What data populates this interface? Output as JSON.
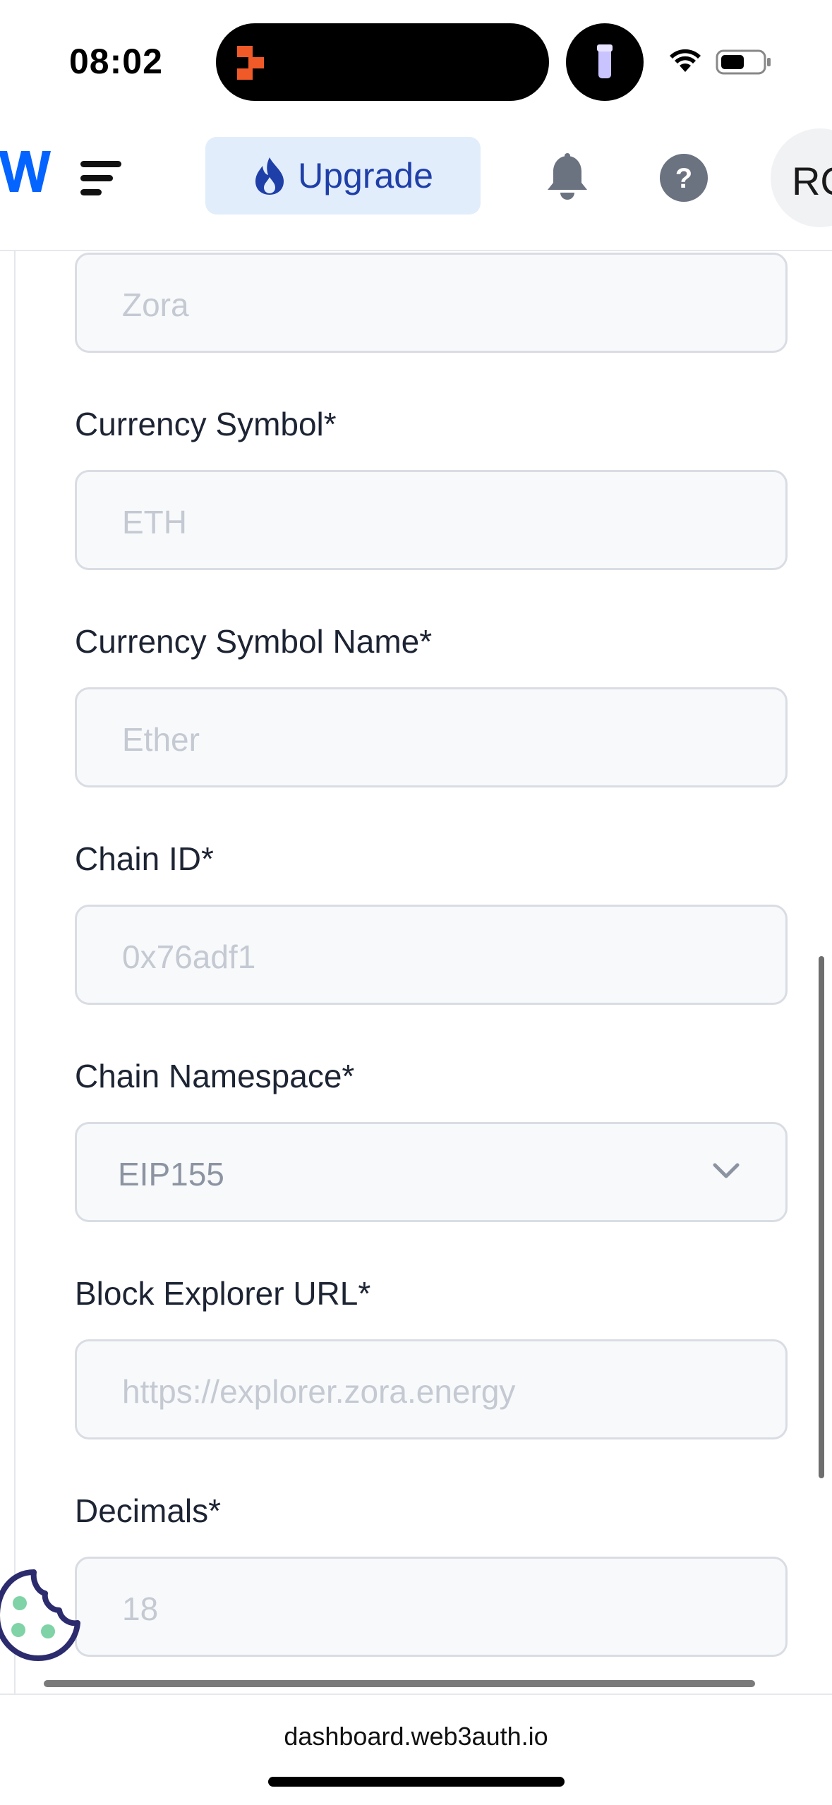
{
  "status_bar": {
    "time": "08:02"
  },
  "header": {
    "logo_icon": "web3auth-logo-icon",
    "menu_icon": "hamburger-menu-icon",
    "upgrade_label": "Upgrade",
    "avatar_initials": "RO"
  },
  "form": {
    "network_name": {
      "placeholder": "Zora"
    },
    "currency_symbol": {
      "label": "Currency Symbol*",
      "placeholder": "ETH"
    },
    "currency_symbol_name": {
      "label": "Currency Symbol Name*",
      "placeholder": "Ether"
    },
    "chain_id": {
      "label": "Chain ID*",
      "placeholder": "0x76adf1"
    },
    "chain_namespace": {
      "label": "Chain Namespace*",
      "value": "EIP155"
    },
    "block_explorer_url": {
      "label": "Block Explorer URL*",
      "placeholder": "https://explorer.zora.energy"
    },
    "decimals": {
      "label": "Decimals*",
      "placeholder": "18"
    }
  },
  "browser": {
    "url": "dashboard.web3auth.io"
  },
  "colors": {
    "accent": "#1f3fa8",
    "upgrade_bg": "#e2edfc",
    "logo_blue": "#0364ff",
    "cookie_green": "#7fd3a6",
    "cookie_outline": "#2b2b6e"
  }
}
